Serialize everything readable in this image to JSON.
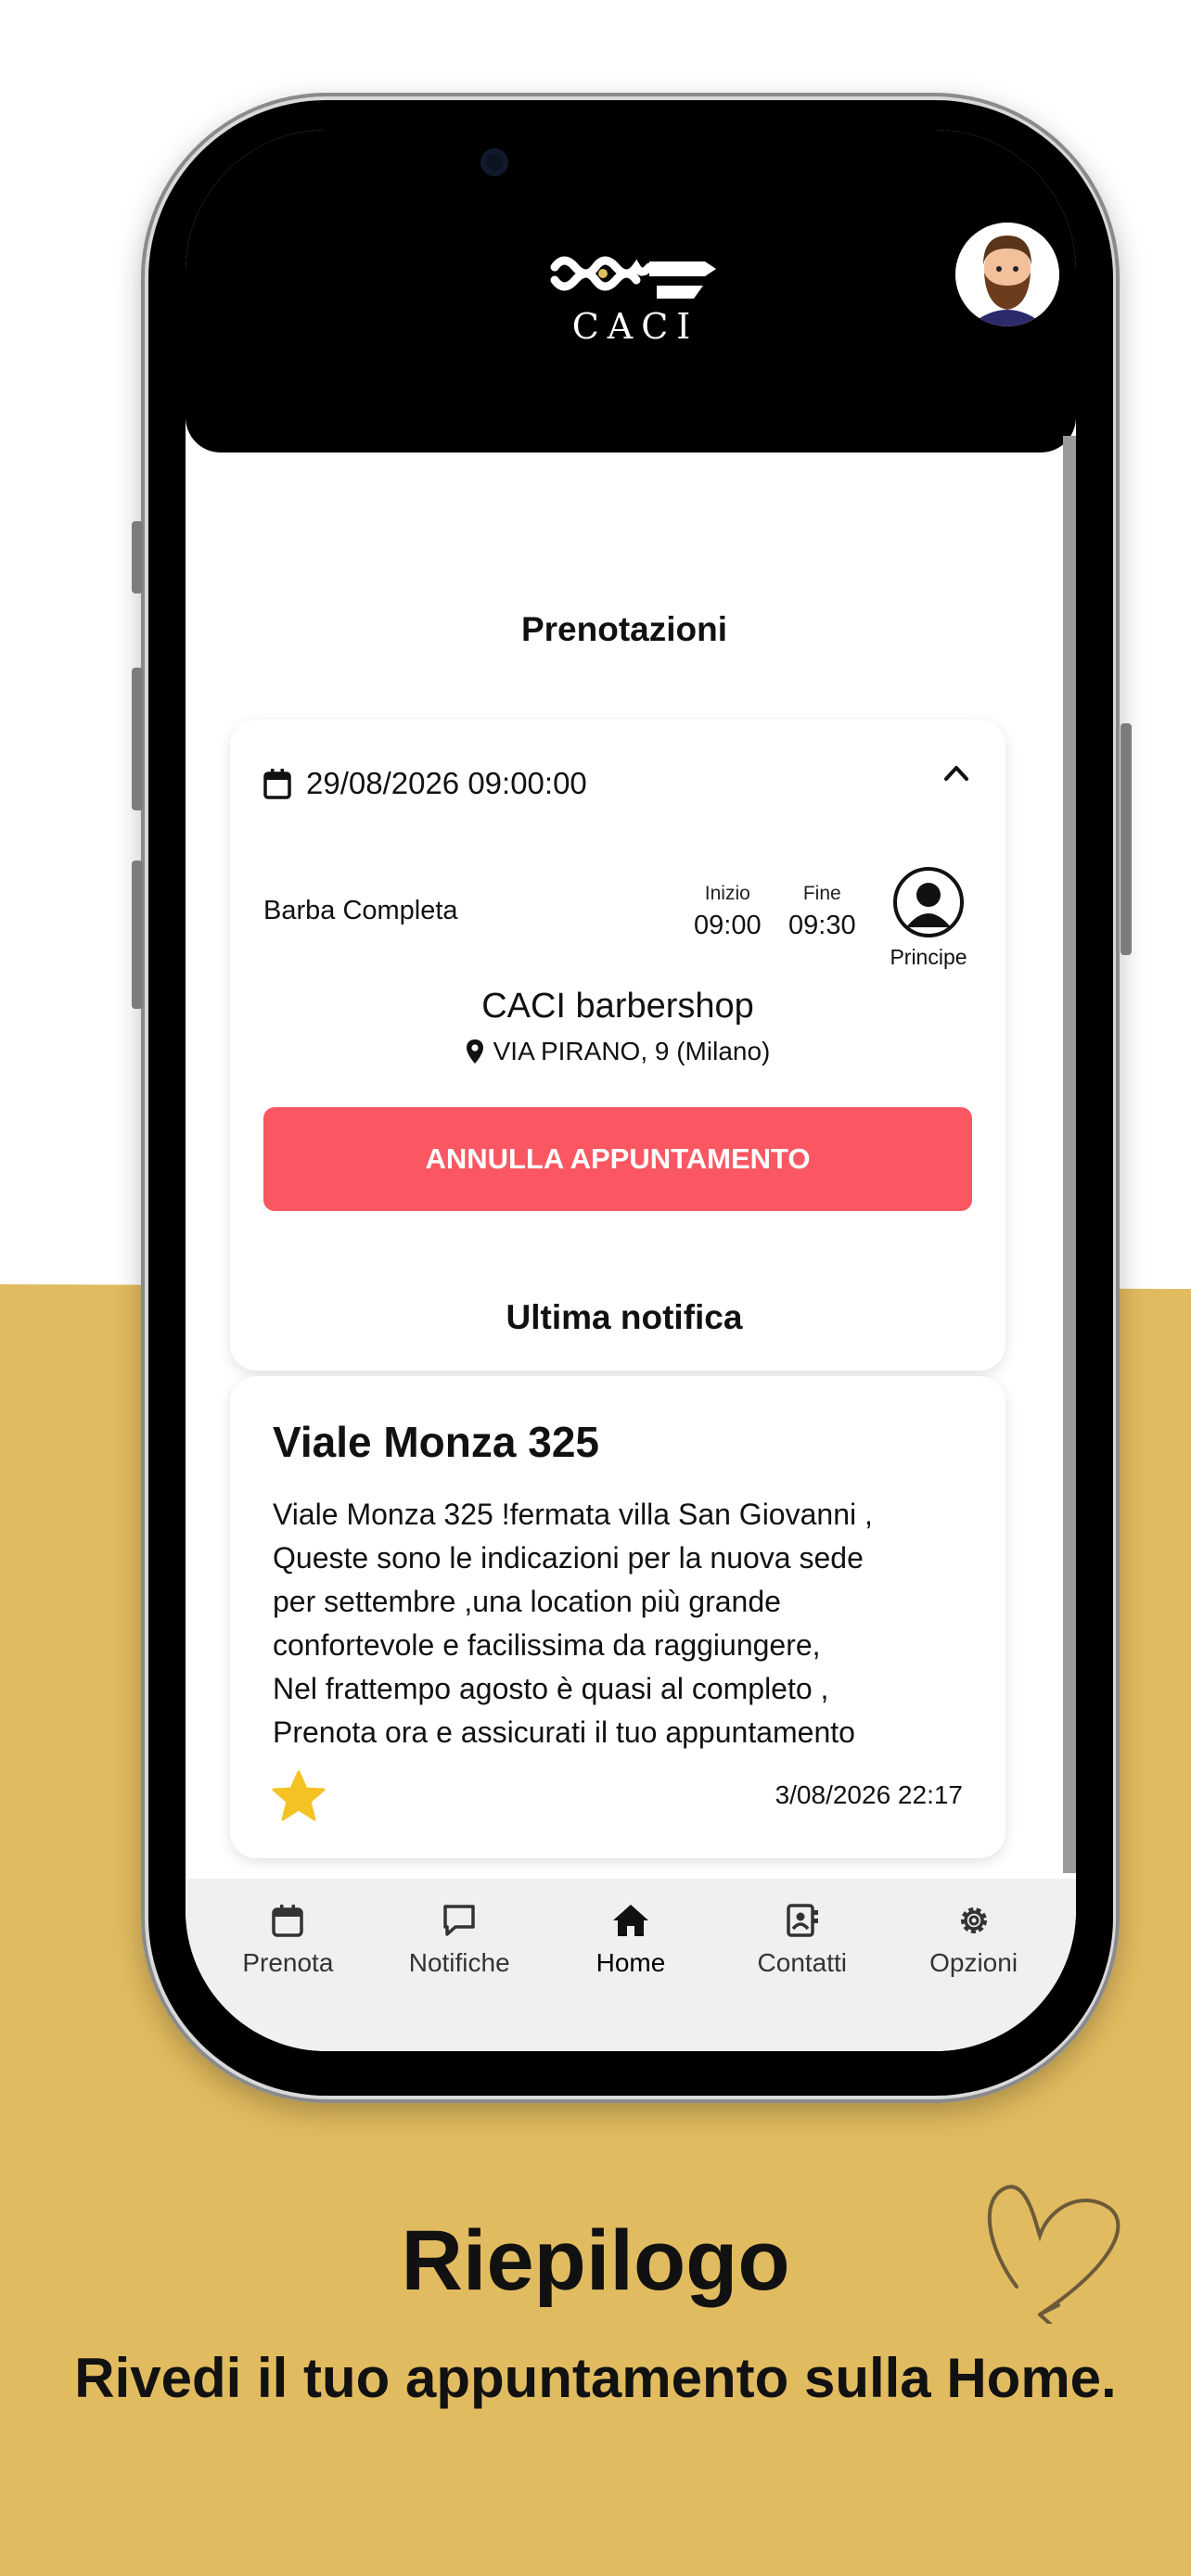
{
  "colors": {
    "gold": "#e1bb5f",
    "accent_red": "#fb5762",
    "star": "#f5c224",
    "black": "#000000"
  },
  "header": {
    "brand": "CACI",
    "logo_icon": "mustache-logo-icon",
    "avatar_icon": "bearded-man-avatar-icon"
  },
  "bookings": {
    "title": "Prenotazioni",
    "card": {
      "datetime": "29/08/2026 09:00:00",
      "service": "Barba Completa",
      "start_label": "Inizio",
      "start_time": "09:00",
      "end_label": "Fine",
      "end_time": "09:30",
      "barber": "Principe",
      "shop": "CACI barbershop",
      "address": "VIA PIRANO, 9 (Milano)",
      "cancel_label": "ANNULLA APPUNTAMENTO"
    }
  },
  "last_notification": {
    "title": "Ultima notifica",
    "heading": "Viale Monza 325",
    "body": "Viale Monza 325 !fermata villa San Giovanni ,\nQueste sono le indicazioni per la nuova sede\nper settembre ,una location più grande\nconfortevole e facilissima da raggiungere,\nNel frattempo agosto è quasi al completo ,\nPrenota ora e assicurati il tuo appuntamento",
    "date": "3/08/2026 22:17"
  },
  "tabbar": {
    "items": [
      {
        "label": "Prenota",
        "icon": "calendar-icon"
      },
      {
        "label": "Notifiche",
        "icon": "chat-bubble-icon"
      },
      {
        "label": "Home",
        "icon": "home-icon"
      },
      {
        "label": "Contatti",
        "icon": "contacts-icon"
      },
      {
        "label": "Opzioni",
        "icon": "gear-icon"
      }
    ],
    "active": "Home"
  },
  "promo": {
    "title": "Riepilogo",
    "subtitle": "Rivedi il tuo appuntamento sulla Home."
  }
}
